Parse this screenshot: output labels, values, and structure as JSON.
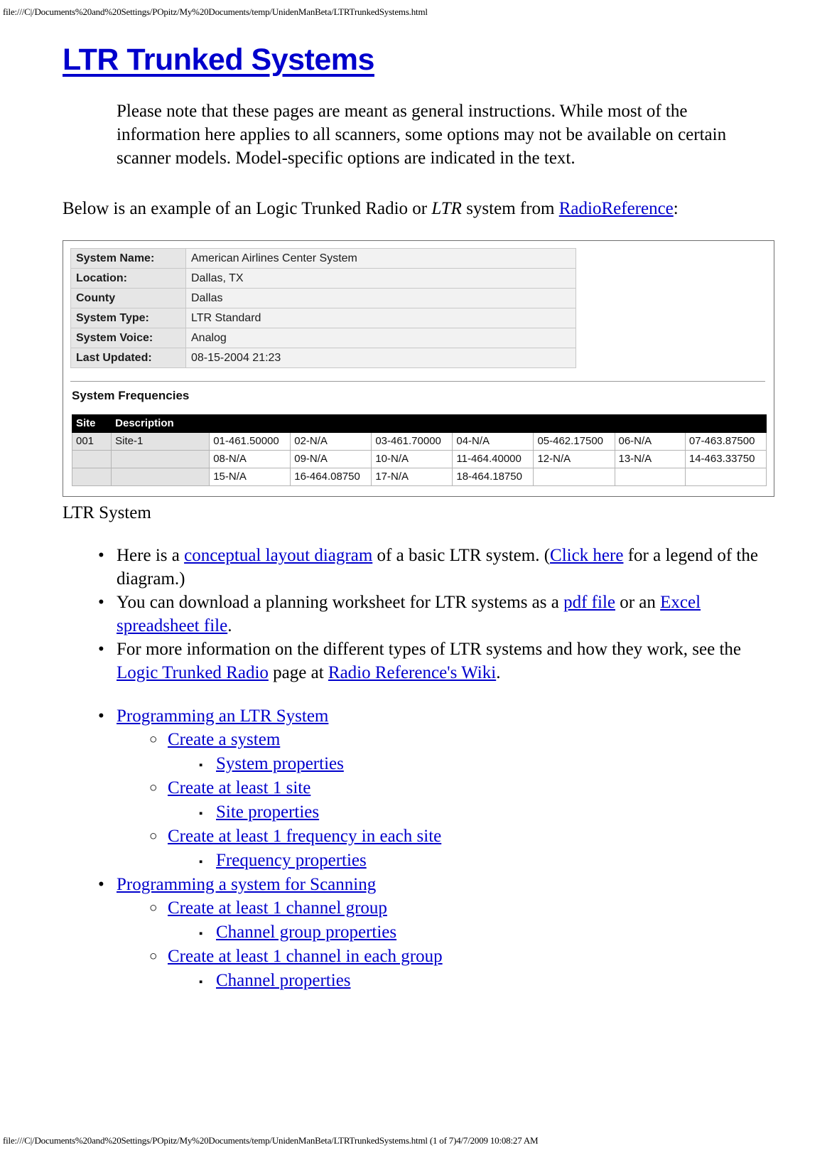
{
  "browser_print": {
    "header_url": "file:///C|/Documents%20and%20Settings/POpitz/My%20Documents/temp/UnidenManBeta/LTRTrunkedSystems.html",
    "footer_url": "file:///C|/Documents%20and%20Settings/POpitz/My%20Documents/temp/UnidenManBeta/LTRTrunkedSystems.html (1 of 7)4/7/2009 10:08:27 AM"
  },
  "colors": {
    "link": "#0000cc",
    "heading": "#0000cc",
    "text": "#000000",
    "table_header_bg": "#000000",
    "table_key_bg": "#e6e6e6",
    "table_value_bg": "#f2f2f2"
  },
  "page": {
    "title": "LTR Trunked Systems",
    "note": "Please note that these pages are meant as general instructions. While most of the information here applies to all scanners, some options may not be available on certain scanner models. Model-specific options are indicated in the text.",
    "lead": {
      "before": "Below is an example of an Logic Trunked Radio or ",
      "italic": "LTR",
      "middle": " system from ",
      "link": "RadioReference",
      "after": ":"
    },
    "figure_caption": "LTR System"
  },
  "screenshot": {
    "info_rows": [
      {
        "label": "System Name:",
        "value": "American Airlines Center System"
      },
      {
        "label": "Location:",
        "value": "Dallas, TX"
      },
      {
        "label": "County",
        "value": "Dallas"
      },
      {
        "label": "System Type:",
        "value": "LTR Standard"
      },
      {
        "label": "System Voice:",
        "value": "Analog"
      },
      {
        "label": "Last Updated:",
        "value": "08-15-2004 21:23"
      }
    ],
    "frequencies_heading": "System Frequencies",
    "freq_headers": [
      "Site",
      "Description",
      "",
      "",
      "",
      "",
      "",
      "",
      ""
    ],
    "freq_rows": [
      {
        "site": "001",
        "desc": "Site-1",
        "freqs": [
          "01-461.50000",
          "02-N/A",
          "03-461.70000",
          "04-N/A",
          "05-462.17500",
          "06-N/A",
          "07-463.87500"
        ]
      },
      {
        "site": "",
        "desc": "",
        "freqs": [
          "08-N/A",
          "09-N/A",
          "10-N/A",
          "11-464.40000",
          "12-N/A",
          "13-N/A",
          "14-463.33750"
        ]
      },
      {
        "site": "",
        "desc": "",
        "freqs": [
          "15-N/A",
          "16-464.08750",
          "17-N/A",
          "18-464.18750",
          "",
          "",
          ""
        ]
      }
    ]
  },
  "info_bullets": [
    {
      "marker": "•",
      "parts": [
        {
          "type": "text",
          "text": "Here is a "
        },
        {
          "type": "link",
          "text": "conceptual layout diagram"
        },
        {
          "type": "text",
          "text": " of a basic LTR system. ("
        },
        {
          "type": "link",
          "text": "Click here"
        },
        {
          "type": "text",
          "text": " for a legend of the diagram.)"
        }
      ]
    },
    {
      "marker": "•",
      "parts": [
        {
          "type": "text",
          "text": "You can download a planning worksheet for LTR systems as a "
        },
        {
          "type": "link",
          "text": "pdf file"
        },
        {
          "type": "text",
          "text": " or an "
        },
        {
          "type": "link",
          "text": "Excel spreadsheet file"
        },
        {
          "type": "text",
          "text": "."
        }
      ]
    },
    {
      "marker": "•",
      "parts": [
        {
          "type": "text",
          "text": "For more information on the different types of LTR systems and how they work, see the "
        },
        {
          "type": "link",
          "text": "Logic Trunked Radio"
        },
        {
          "type": "text",
          "text": " page at "
        },
        {
          "type": "link",
          "text": "Radio Reference's Wiki"
        },
        {
          "type": "text",
          "text": "."
        }
      ]
    }
  ],
  "nav": {
    "markers": {
      "level1": "•",
      "level2": "○",
      "level3": "▪"
    },
    "groups": [
      {
        "label": "Programming an LTR System",
        "children": [
          {
            "label": "Create a system",
            "children": [
              {
                "label": "System properties"
              }
            ]
          },
          {
            "label": "Create at least 1 site",
            "children": [
              {
                "label": "Site properties"
              }
            ]
          },
          {
            "label": "Create at least 1 frequency in each site",
            "children": [
              {
                "label": "Frequency properties"
              }
            ]
          }
        ]
      },
      {
        "label": "Programming a system for Scanning",
        "children": [
          {
            "label": "Create at least 1 channel group",
            "children": [
              {
                "label": "Channel group properties"
              }
            ]
          },
          {
            "label": "Create at least 1 channel in each group",
            "children": [
              {
                "label": "Channel properties"
              }
            ]
          }
        ]
      }
    ]
  }
}
